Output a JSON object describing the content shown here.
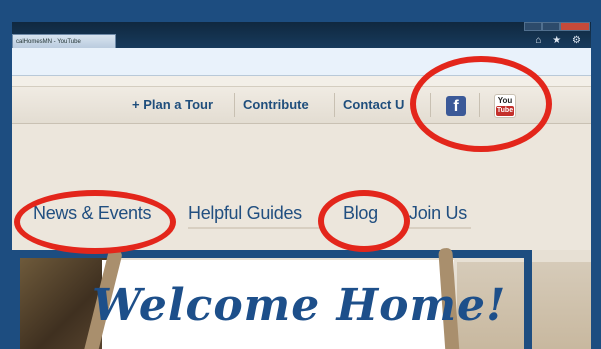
{
  "browser": {
    "tab_title": "calHomesMN - YouTube",
    "toolbar_icons": "⌂ ★ ⚙"
  },
  "top_nav": {
    "items": [
      {
        "label": "+ Plan a Tour"
      },
      {
        "label": "Contribute"
      },
      {
        "label": "Contact U"
      }
    ],
    "facebook_icon": "f",
    "youtube_icon": {
      "top": "You",
      "bottom": "Tube"
    }
  },
  "main_nav": {
    "items": [
      {
        "label": "News & Events"
      },
      {
        "label": "Helpful Guides"
      },
      {
        "label": "Blog"
      },
      {
        "label": "Join Us"
      }
    ]
  },
  "banner": {
    "headline": "Welcome Home!"
  },
  "colors": {
    "annotation": "#e3261b",
    "link": "#214f80",
    "frame": "#1d4d80"
  }
}
